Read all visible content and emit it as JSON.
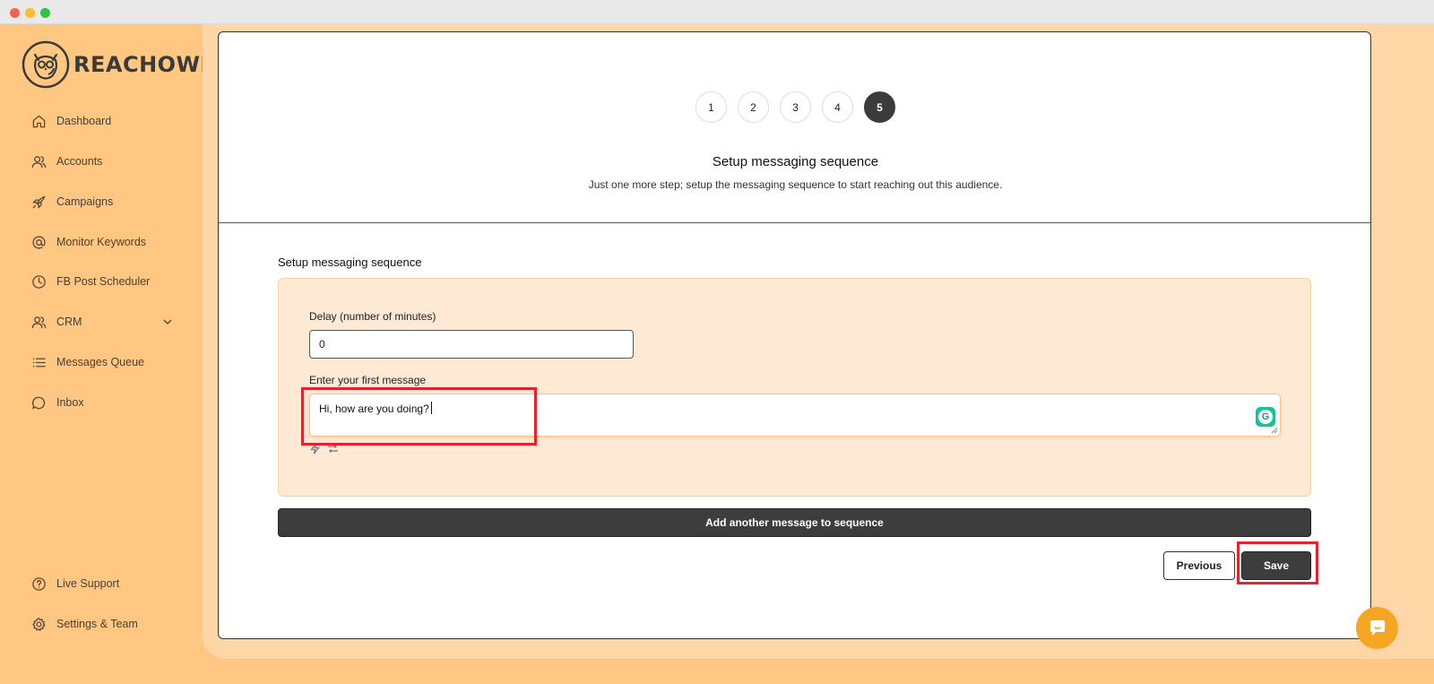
{
  "app": {
    "name": "REACHOWL"
  },
  "sidebar": {
    "items": [
      {
        "label": "Dashboard",
        "icon": "home-icon"
      },
      {
        "label": "Accounts",
        "icon": "users-icon"
      },
      {
        "label": "Campaigns",
        "icon": "rocket-icon"
      },
      {
        "label": "Monitor Keywords",
        "icon": "at-sign-icon"
      },
      {
        "label": "FB Post Scheduler",
        "icon": "clock-icon"
      },
      {
        "label": "CRM",
        "icon": "users-icon"
      },
      {
        "label": "Messages Queue",
        "icon": "list-icon"
      },
      {
        "label": "Inbox",
        "icon": "chat-icon"
      }
    ],
    "footer": [
      {
        "label": "Live Support",
        "icon": "help-circle-icon"
      },
      {
        "label": "Settings & Team",
        "icon": "gear-icon"
      }
    ]
  },
  "wizard": {
    "steps": [
      "1",
      "2",
      "3",
      "4",
      "5"
    ],
    "active_step": 5,
    "title": "Setup messaging sequence",
    "subtitle": "Just one more step; setup the messaging sequence to start reaching out this audience."
  },
  "sequence": {
    "section_title": "Setup messaging sequence",
    "delay_label": "Delay (number of minutes)",
    "delay_value": "0",
    "message_label": "Enter your first message",
    "message_value": "Hi, how are you doing?"
  },
  "buttons": {
    "add_message": "Add another message to sequence",
    "previous": "Previous",
    "save": "Save"
  },
  "colors": {
    "sidebar_bg": "#ffc782",
    "main_bg": "#ffd7a6",
    "sequence_box_bg": "#fde9d4",
    "dark_button": "#3d3d3d",
    "highlight": "#e5212b",
    "chat_bubble": "#f5a623"
  }
}
